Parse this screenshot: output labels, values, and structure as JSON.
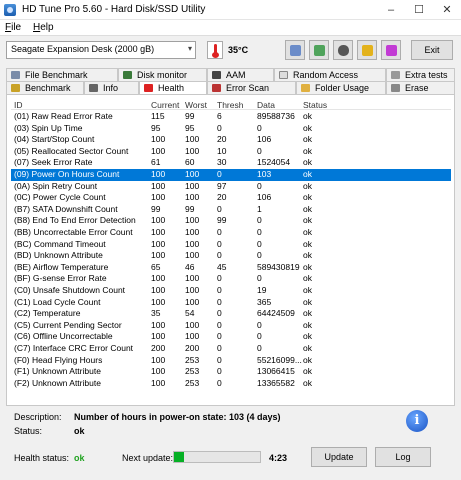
{
  "window": {
    "title": "HD Tune Pro 5.60 - Hard Disk/SSD Utility",
    "min_glyph": "–",
    "max_glyph": "☐",
    "close_glyph": "✕"
  },
  "menu": {
    "file": "File",
    "help": "Help"
  },
  "toolbar": {
    "drive": "Seagate Expansion Desk (2000 gB)",
    "dropdown_glyph": "▾",
    "temperature": "35°C",
    "exit": "Exit"
  },
  "tabs": {
    "file_benchmark": "File Benchmark",
    "disk_monitor": "Disk monitor",
    "aam": "AAM",
    "random_access": "Random Access",
    "extra_tests": "Extra tests",
    "benchmark": "Benchmark",
    "info": "Info",
    "health": "Health",
    "error_scan": "Error Scan",
    "folder_usage": "Folder Usage",
    "erase": "Erase"
  },
  "table": {
    "headers": {
      "id": "ID",
      "current": "Current",
      "worst": "Worst",
      "threshold": "Thresh",
      "data": "Data",
      "status": "Status"
    },
    "rows": [
      {
        "id": "(01) Raw Read Error Rate",
        "current": "115",
        "worst": "99",
        "threshold": "6",
        "data": "89588736",
        "status": "ok"
      },
      {
        "id": "(03) Spin Up Time",
        "current": "95",
        "worst": "95",
        "threshold": "0",
        "data": "0",
        "status": "ok"
      },
      {
        "id": "(04) Start/Stop Count",
        "current": "100",
        "worst": "100",
        "threshold": "20",
        "data": "106",
        "status": "ok"
      },
      {
        "id": "(05) Reallocated Sector Count",
        "current": "100",
        "worst": "100",
        "threshold": "10",
        "data": "0",
        "status": "ok"
      },
      {
        "id": "(07) Seek Error Rate",
        "current": "61",
        "worst": "60",
        "threshold": "30",
        "data": "1524054",
        "status": "ok"
      },
      {
        "id": "(09) Power On Hours Count",
        "current": "100",
        "worst": "100",
        "threshold": "0",
        "data": "103",
        "status": "ok"
      },
      {
        "id": "(0A) Spin Retry Count",
        "current": "100",
        "worst": "100",
        "threshold": "97",
        "data": "0",
        "status": "ok"
      },
      {
        "id": "(0C) Power Cycle Count",
        "current": "100",
        "worst": "100",
        "threshold": "20",
        "data": "106",
        "status": "ok"
      },
      {
        "id": "(B7) SATA Downshift Count",
        "current": "99",
        "worst": "99",
        "threshold": "0",
        "data": "1",
        "status": "ok"
      },
      {
        "id": "(B8) End To End Error Detection",
        "current": "100",
        "worst": "100",
        "threshold": "99",
        "data": "0",
        "status": "ok"
      },
      {
        "id": "(BB) Uncorrectable Error Count",
        "current": "100",
        "worst": "100",
        "threshold": "0",
        "data": "0",
        "status": "ok"
      },
      {
        "id": "(BC) Command Timeout",
        "current": "100",
        "worst": "100",
        "threshold": "0",
        "data": "0",
        "status": "ok"
      },
      {
        "id": "(BD) Unknown Attribute",
        "current": "100",
        "worst": "100",
        "threshold": "0",
        "data": "0",
        "status": "ok"
      },
      {
        "id": "(BE) Airflow Temperature",
        "current": "65",
        "worst": "46",
        "threshold": "45",
        "data": "589430819",
        "status": "ok"
      },
      {
        "id": "(BF) G-sense Error Rate",
        "current": "100",
        "worst": "100",
        "threshold": "0",
        "data": "0",
        "status": "ok"
      },
      {
        "id": "(C0) Unsafe Shutdown Count",
        "current": "100",
        "worst": "100",
        "threshold": "0",
        "data": "19",
        "status": "ok"
      },
      {
        "id": "(C1) Load Cycle Count",
        "current": "100",
        "worst": "100",
        "threshold": "0",
        "data": "365",
        "status": "ok"
      },
      {
        "id": "(C2) Temperature",
        "current": "35",
        "worst": "54",
        "threshold": "0",
        "data": "64424509",
        "status": "ok"
      },
      {
        "id": "(C5) Current Pending Sector",
        "current": "100",
        "worst": "100",
        "threshold": "0",
        "data": "0",
        "status": "ok"
      },
      {
        "id": "(C6) Offline Uncorrectable",
        "current": "100",
        "worst": "100",
        "threshold": "0",
        "data": "0",
        "status": "ok"
      },
      {
        "id": "(C7) Interface CRC Error Count",
        "current": "200",
        "worst": "200",
        "threshold": "0",
        "data": "0",
        "status": "ok"
      },
      {
        "id": "(F0) Head Flying Hours",
        "current": "100",
        "worst": "253",
        "threshold": "0",
        "data": "55216099...",
        "status": "ok"
      },
      {
        "id": "(F1) Unknown Attribute",
        "current": "100",
        "worst": "253",
        "threshold": "0",
        "data": "13066415",
        "status": "ok"
      },
      {
        "id": "(F2) Unknown Attribute",
        "current": "100",
        "worst": "253",
        "threshold": "0",
        "data": "13365582",
        "status": "ok"
      }
    ],
    "selected_index": 5
  },
  "details": {
    "description_label": "Description:",
    "description": "Number of hours in power-on state: 103 (4 days)",
    "status_label": "Status:",
    "status": "ok"
  },
  "footer": {
    "health_label": "Health status:",
    "health_value": "ok",
    "next_update_label": "Next update:",
    "progress": 0.12,
    "timer": "4:23",
    "update": "Update",
    "log": "Log"
  },
  "colors": {
    "selection": "#0078d7",
    "health_ok": "#22a322",
    "progress": "#06b025"
  }
}
